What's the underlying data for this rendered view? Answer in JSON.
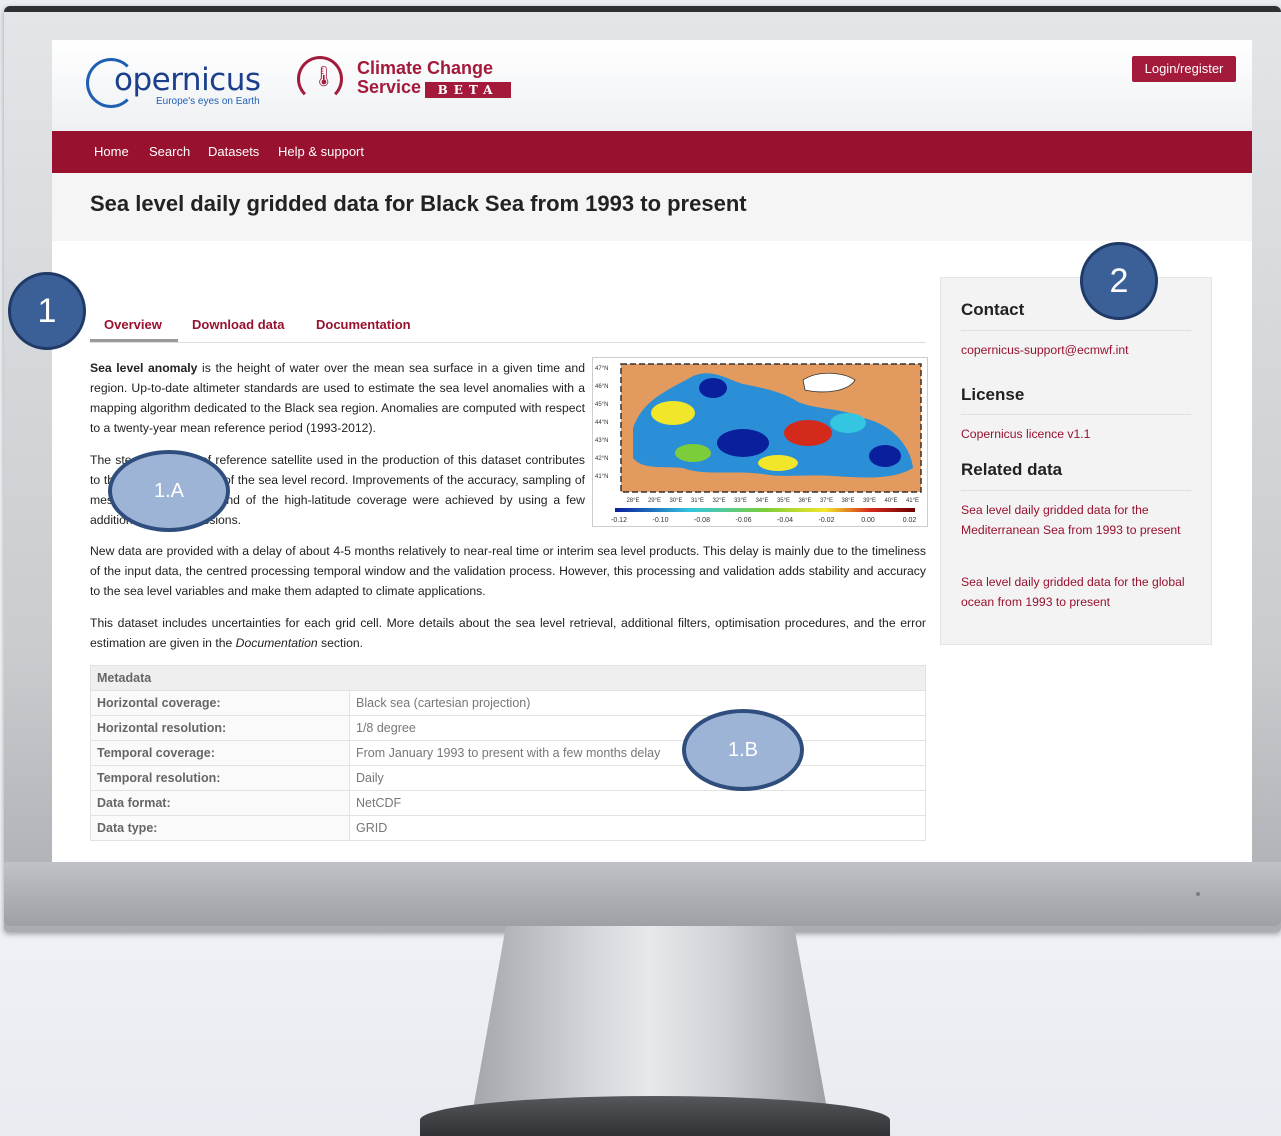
{
  "header": {
    "copernicus_logo_text": "opernicus",
    "copernicus_tagline": "Europe's eyes on Earth",
    "c3s_line1": "Climate Change",
    "c3s_line2": "Service",
    "c3s_beta": "BETA",
    "login_label": "Login/register"
  },
  "nav": {
    "items": [
      "Home",
      "Search",
      "Datasets",
      "Help & support"
    ]
  },
  "page": {
    "title": "Sea level daily gridded data for Black Sea from 1993 to present"
  },
  "tabs": [
    "Overview",
    "Download data",
    "Documentation"
  ],
  "overview": {
    "p1_bold": "Sea level anomaly",
    "p1_rest": " is the height of water over the mean sea surface in a given time and region. Up-to-date altimeter standards are used to estimate the sea level anomalies with a mapping algorithm dedicated to the Black sea region. Anomalies are computed with respect to a twenty-year mean reference period (1993-2012).",
    "p2": "The steady number of reference satellite used in the production of this dataset contributes to the long-term stability of the sea level record. Improvements of the accuracy, sampling of meso-scale processes and of the high-latitude coverage were achieved by using a few additional satellite missions.",
    "p3": "New data are provided with a delay of about 4-5 months relatively to near-real time or interim sea level products. This delay is mainly due to the timeliness of the input data, the centred processing temporal window and the validation process. However, this processing and validation adds stability and accuracy to the sea level variables and make them adapted to climate applications.",
    "p4_a": "This dataset includes uncertainties for each grid cell. More details about the sea level retrieval, additional filters, optimisation procedures, and the error estimation are given in the ",
    "p4_em": "Documentation",
    "p4_b": " section."
  },
  "map": {
    "lat_labels": [
      "47°N",
      "46°N",
      "45°N",
      "44°N",
      "43°N",
      "42°N",
      "41°N"
    ],
    "lon_labels": [
      "28°E",
      "29°E",
      "30°E",
      "31°E",
      "32°E",
      "33°E",
      "34°E",
      "35°E",
      "36°E",
      "37°E",
      "38°E",
      "39°E",
      "40°E",
      "41°E"
    ],
    "colorbar_labels": [
      "-0.12",
      "-0.10",
      "-0.08",
      "-0.06",
      "-0.04",
      "-0.02",
      "0.00",
      "0.02"
    ],
    "land_color": "#e39a5e",
    "sea_color": "#2a8fd6"
  },
  "metadata": {
    "heading": "Metadata",
    "rows": [
      {
        "key": "Horizontal coverage:",
        "value": "Black sea (cartesian projection)"
      },
      {
        "key": "Horizontal resolution:",
        "value": "1/8 degree"
      },
      {
        "key": "Temporal coverage:",
        "value": "From January 1993 to present with a few months delay"
      },
      {
        "key": "Temporal resolution:",
        "value": "Daily"
      },
      {
        "key": "Data format:",
        "value": "NetCDF"
      },
      {
        "key": "Data type:",
        "value": "GRID"
      }
    ]
  },
  "sidebar": {
    "contact_title": "Contact",
    "contact_email": "copernicus-support@ecmwf.int",
    "license_title": "License",
    "license_link": "Copernicus licence v1.1",
    "related_title": "Related data",
    "related_links": [
      "Sea level daily gridded data for the Mediterranean Sea from 1993 to present",
      "Sea level daily gridded data for the global ocean from 1993 to present"
    ]
  },
  "callouts": {
    "c1": "1",
    "c2": "2",
    "c1a": "1.A",
    "c1b": "1.B"
  },
  "colors": {
    "brand": "#98112f",
    "callout": "#3b5f97"
  }
}
